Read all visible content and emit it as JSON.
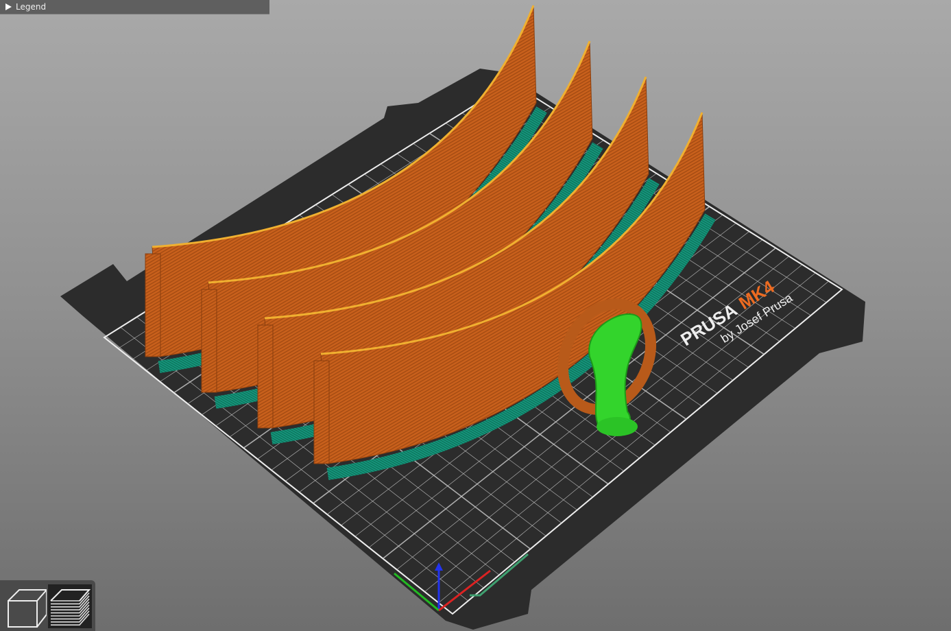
{
  "legend": {
    "label": "Legend",
    "icon": "triangle-right-icon"
  },
  "bed": {
    "brand": "PRUSA",
    "model": "MK4",
    "byline": "by Josef Prusa"
  },
  "view_buttons": [
    {
      "name": "3d-view",
      "icon": "cube-icon",
      "active": false
    },
    {
      "name": "preview",
      "icon": "layers-icon",
      "active": true
    }
  ],
  "colors": {
    "bed": "#2d2d2d",
    "grid": "#e8e8e8",
    "perimeter": "#d0661e",
    "base": "#139277",
    "support": "#2fd12b",
    "accent": "#ed6b21"
  }
}
